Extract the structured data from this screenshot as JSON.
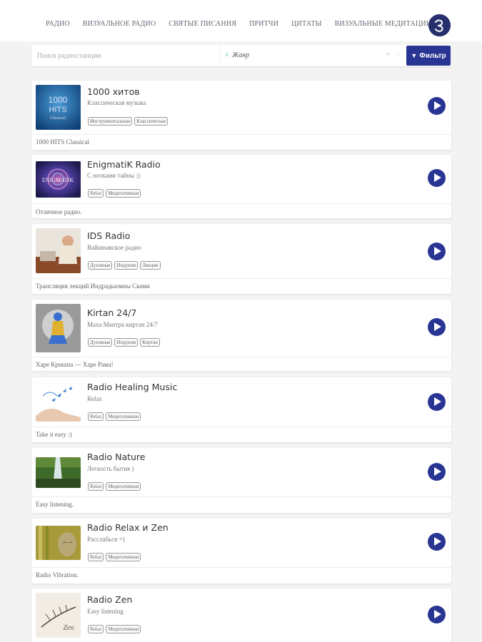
{
  "nav": [
    "РАДИО",
    "ВИЗУАЛЬНОЕ РАДИО",
    "СВЯТЫЕ ПИСАНИЯ",
    "ПРИТЧИ",
    "ЦИТАТЫ",
    "ВИЗУАЛЬНЫЕ МЕДИТАЦИИ"
  ],
  "search": {
    "placeholder": "Поиск радиостанции"
  },
  "genre": {
    "label": "Жанр"
  },
  "filter_button": "Фильтр",
  "colors": {
    "accent": "#283593",
    "background": "#f3f3f3"
  },
  "stations": [
    {
      "title": "1000 хитов",
      "subtitle": "Классическая музыка",
      "tags": [
        "Инструментальная",
        "Классическая"
      ],
      "description": "1000 HITS Classical",
      "thumb_text": "1000 HITS"
    },
    {
      "title": "EnigmatiK Radio",
      "subtitle": "С нотками тайны :)",
      "tags": [
        "Relax",
        "Медитативная"
      ],
      "description": "Отличное радио.",
      "thumb_text": "ENIGMATIK"
    },
    {
      "title": "IDS Radio",
      "subtitle": "Вайшнавское радио",
      "tags": [
        "Духовная",
        "Индуизм",
        "Лекции"
      ],
      "description": "Трансляция лекций Индрадьюмны Свами",
      "thumb_text": ""
    },
    {
      "title": "Kirtan 24/7",
      "subtitle": "Маха Мантра киртан 24/7",
      "tags": [
        "Духовная",
        "Индуизм",
        "Киртан"
      ],
      "description": "Харе Кришна — Харе Рама!",
      "thumb_text": ""
    },
    {
      "title": "Radio Healing Music",
      "subtitle": "Relax",
      "tags": [
        "Relax",
        "Медитативная"
      ],
      "description": "Take it easy :)",
      "thumb_text": ""
    },
    {
      "title": "Radio Nature",
      "subtitle": "Легкость бытия )",
      "tags": [
        "Relax",
        "Медитативная"
      ],
      "description": "Easy listening.",
      "thumb_text": ""
    },
    {
      "title": "Radio Relax и Zen",
      "subtitle": "Расслабься =)",
      "tags": [
        "Relax",
        "Медитативная"
      ],
      "description": "Radio Vibration.",
      "thumb_text": ""
    },
    {
      "title": "Radio Zen",
      "subtitle": "Easy listening",
      "tags": [
        "Relax",
        "Медитативная"
      ],
      "description": "",
      "thumb_text": "Zen"
    }
  ]
}
